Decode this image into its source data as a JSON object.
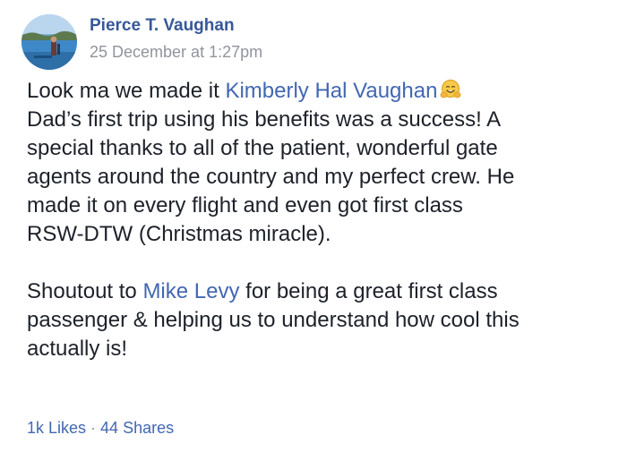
{
  "author": {
    "name": "Pierce T. Vaughan",
    "timestamp": "25 December at 1:27pm",
    "avatar_icon": "profile-photo-beach"
  },
  "post": {
    "p1": {
      "line1_prefix": "Look ma we made it ",
      "mention1": "Kimberly Hal Vaughan",
      "emoji": "hugging-face-icon",
      "line2": "Dad’s first trip using his benefits was a success! A",
      "line3": "special thanks to all of the patient, wonderful gate",
      "line4": "agents around the country and my perfect crew. He",
      "line5": "made it on every flight and even got first class",
      "line6": "RSW-DTW (Christmas miracle)."
    },
    "p2": {
      "line1_prefix": "Shoutout to ",
      "mention2": "Mike Levy",
      "line1_suffix": " for being a great first class",
      "line2": "passenger & helping us to understand how cool this",
      "line3": "actually is!"
    }
  },
  "stats": {
    "likes": "1k Likes",
    "separator": "·",
    "shares": "44 Shares"
  },
  "colors": {
    "link": "#4267b2",
    "author": "#365899",
    "muted": "#90949c",
    "text": "#1d2129"
  }
}
